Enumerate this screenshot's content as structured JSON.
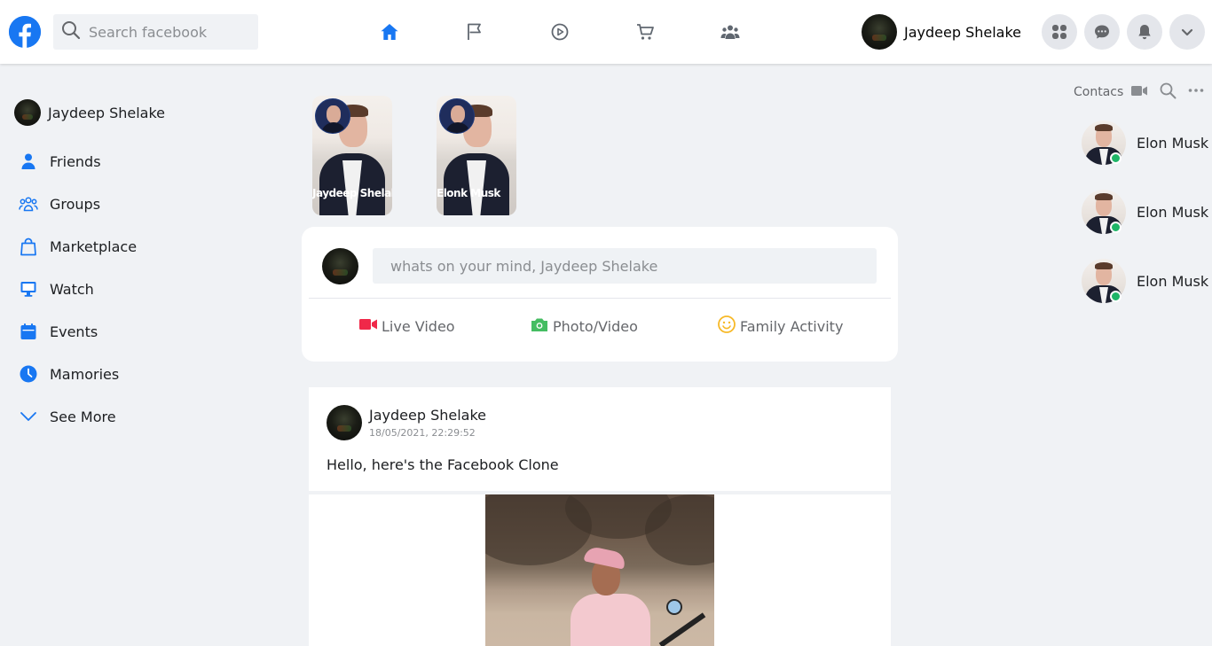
{
  "header": {
    "search_placeholder": "Search facebook",
    "nav": [
      "home-icon",
      "flag-icon",
      "watch-icon",
      "marketplace-icon",
      "groups-icon"
    ],
    "profile_name": "Jaydeep Shelake",
    "active_color": "#1877f2"
  },
  "sidebar": {
    "profile_name": "Jaydeep Shelake",
    "items": [
      {
        "label": "Friends",
        "icon": "friends-icon"
      },
      {
        "label": "Groups",
        "icon": "groups-icon"
      },
      {
        "label": "Marketplace",
        "icon": "marketplace-bag-icon"
      },
      {
        "label": "Watch",
        "icon": "monitor-icon"
      },
      {
        "label": "Events",
        "icon": "calendar-icon"
      },
      {
        "label": "Mamories",
        "icon": "clock-icon"
      },
      {
        "label": "See More",
        "icon": "chevron-down-icon"
      }
    ]
  },
  "stories": [
    {
      "name": "Jaydeep Shelake"
    },
    {
      "name": "Elonk Musk"
    }
  ],
  "composer": {
    "placeholder": "whats on your mind, Jaydeep Shelake",
    "actions": [
      {
        "label": "Live Video",
        "color": "#f02849"
      },
      {
        "label": "Photo/Video",
        "color": "#45bd62"
      },
      {
        "label": "Family Activity",
        "color": "#f7b928"
      }
    ]
  },
  "post": {
    "author": "Jaydeep Shelake",
    "timestamp": "18/05/2021, 22:29:52",
    "text": "Hello, here's the Facebook Clone"
  },
  "contacts": {
    "title": "Contacs",
    "list": [
      {
        "name": "Elon Musk",
        "online": true
      },
      {
        "name": "Elon Musk",
        "online": true
      },
      {
        "name": "Elon Musk",
        "online": true
      }
    ]
  }
}
